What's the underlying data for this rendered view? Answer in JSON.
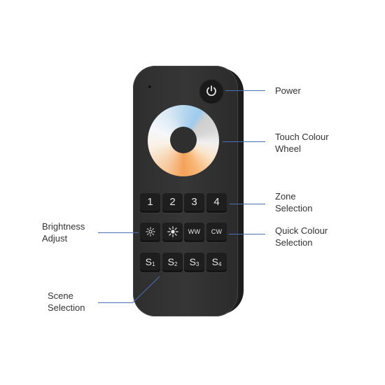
{
  "remote": {
    "keys": {
      "zones": [
        "1",
        "2",
        "3",
        "4"
      ],
      "quick": [
        "WW",
        "CW"
      ],
      "scenes": [
        {
          "letter": "S",
          "num": "1"
        },
        {
          "letter": "S",
          "num": "2"
        },
        {
          "letter": "S",
          "num": "3"
        },
        {
          "letter": "S",
          "num": "4"
        }
      ]
    },
    "icons": {
      "power": "power-icon",
      "brightness_down": "brightness-down-icon",
      "brightness_up": "brightness-up-icon"
    }
  },
  "labels": {
    "power": "Power",
    "touch_wheel": [
      "Touch Colour",
      "Wheel"
    ],
    "zone": [
      "Zone",
      "Selection"
    ],
    "quick_colour": [
      "Quick Colour",
      "Selection"
    ],
    "brightness": [
      "Brightness",
      "Adjust"
    ],
    "scene": [
      "Scene",
      "Selection"
    ]
  },
  "colors": {
    "leader_line": "#4a6fb5",
    "remote_body": "#2e2e2e",
    "wheel_warm": "#f4a25a",
    "wheel_cool": "#9ecbed"
  }
}
